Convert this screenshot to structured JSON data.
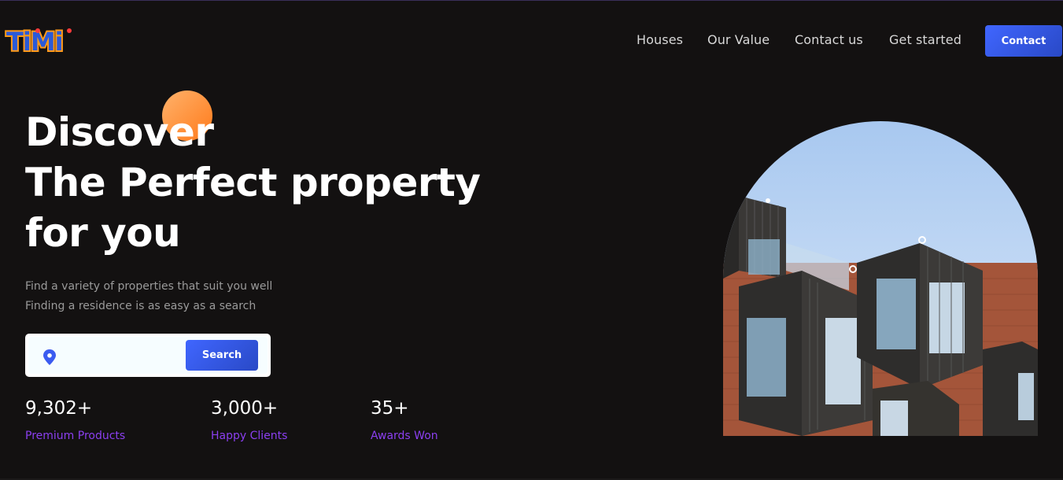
{
  "brand": {
    "logo_text": "Timi"
  },
  "nav": {
    "links": [
      "Houses",
      "Our Value",
      "Contact us",
      "Get started"
    ],
    "cta_label": "Contact"
  },
  "hero": {
    "title_lines": [
      "Discover",
      "The Perfect property",
      "for you"
    ],
    "subtitle_lines": [
      "Find a variety of properties that suit you well",
      "Finding a residence is as easy as a search"
    ],
    "search": {
      "placeholder": "",
      "button_label": "Search",
      "icon": "location-pin-icon"
    }
  },
  "stats": [
    {
      "value": "9,302+",
      "label": "Premium Products"
    },
    {
      "value": "3,000+",
      "label": "Happy Clients"
    },
    {
      "value": "35+",
      "label": "Awards Won"
    }
  ],
  "colors": {
    "background": "#131111",
    "accent_blue": "#4066ff",
    "accent_orange": "#ff8c2e",
    "stat_label": "#8b3ff0"
  }
}
